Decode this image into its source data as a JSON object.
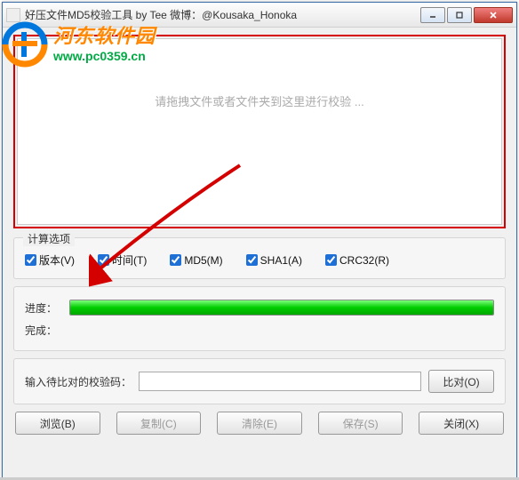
{
  "titlebar": {
    "text": "好压文件MD5校验工具 by Tee     微博：@Kousaka_Honoka"
  },
  "dropzone": {
    "placeholder": "请拖拽文件或者文件夹到这里进行校验 ..."
  },
  "options": {
    "title": "计算选项",
    "items": [
      {
        "label": "版本(V)",
        "checked": true
      },
      {
        "label": "时间(T)",
        "checked": true
      },
      {
        "label": "MD5(M)",
        "checked": true
      },
      {
        "label": "SHA1(A)",
        "checked": true
      },
      {
        "label": "CRC32(R)",
        "checked": true
      }
    ]
  },
  "progress": {
    "label_progress": "进度：",
    "label_done": "完成：",
    "percent": 100
  },
  "compare": {
    "label": "输入待比对的校验码：",
    "value": "",
    "button": "比对(O)"
  },
  "buttons": {
    "browse": "浏览(B)",
    "copy": "复制(C)",
    "clear": "清除(E)",
    "save": "保存(S)",
    "close": "关闭(X)"
  },
  "watermark": {
    "cn": "河东软件园",
    "url": "www.pc0359.cn"
  },
  "colors": {
    "highlight_border": "#d40000",
    "progress_green": "#00cc00",
    "wm_orange": "#ff8800",
    "wm_green": "#00aa44"
  }
}
